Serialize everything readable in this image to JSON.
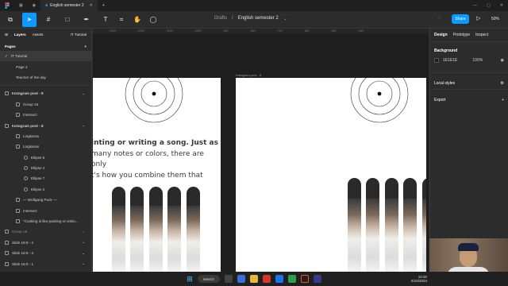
{
  "window": {
    "tabs": [
      "English semester 2"
    ]
  },
  "toolbar": {
    "breadcrumb_folder": "Drafts",
    "breadcrumb_sep": "/",
    "file_title": "English semester 2",
    "share_label": "Share",
    "zoom": "50%"
  },
  "left_panel": {
    "tabs": [
      "Layers",
      "Assets"
    ],
    "page_select": "IT Tutorial",
    "pages_header": "Pages",
    "pages": [
      "IT Tutorial",
      "Page 3",
      "Teacher of the day"
    ],
    "layers": [
      {
        "label": "Instagram post - 8",
        "level": 0,
        "bold": true
      },
      {
        "label": "Group 16",
        "level": 1
      },
      {
        "label": "Intersect",
        "level": 1
      },
      {
        "label": "Instagram post - 8",
        "level": 0,
        "bold": true
      },
      {
        "label": "Lingkaran",
        "level": 1
      },
      {
        "label": "Lingkaran",
        "level": 1
      },
      {
        "label": "Ellipse 5",
        "level": 2
      },
      {
        "label": "Ellipse 4",
        "level": 2
      },
      {
        "label": "Ellipse 7",
        "level": 2
      },
      {
        "label": "Ellipse 2",
        "level": 2
      },
      {
        "label": "— Wolfgang Puck —",
        "level": 1
      },
      {
        "label": "Intersect",
        "level": 1
      },
      {
        "label": "\"Cooking is like painting or writin...",
        "level": 1
      },
      {
        "label": "Group 18",
        "level": 0,
        "dim": true
      },
      {
        "label": "Slide 16:9 - 2",
        "level": 0
      },
      {
        "label": "Slide 16:9 - 3",
        "level": 0
      },
      {
        "label": "Slide 16:9 - 1",
        "level": 0
      }
    ]
  },
  "right_panel": {
    "tabs": [
      "Design",
      "Prototype",
      "Inspect"
    ],
    "background_header": "Background",
    "background_hex": "1E1E1E",
    "background_opacity": "100%",
    "local_styles": "Local styles",
    "export": "Export"
  },
  "canvas": {
    "frame2_label": "Instagram post - 8",
    "quote_lines": [
      "inting or writing a song. Just as",
      "many notes or colors, there are only",
      "t's how you combine them that"
    ],
    "ruler_ticks": [
      "-1300",
      "-1200",
      "-1100",
      "-1000",
      "-900",
      "-800",
      "-700",
      "-600",
      "-500",
      "-400"
    ]
  },
  "taskbar": {
    "search_label": "Search",
    "time": "10:20",
    "date": "5/10/2023"
  },
  "colors": {
    "accent": "#0d99ff",
    "canvas_bg": "#1e1e1e",
    "panel_bg": "#2c2c2c"
  }
}
